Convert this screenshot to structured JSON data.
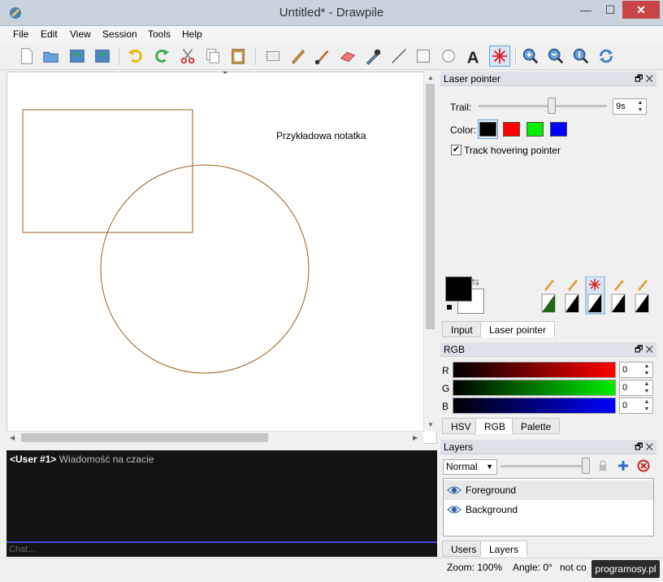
{
  "window": {
    "title": "Untitled* - Drawpile",
    "minimize": "—",
    "maximize": "☐",
    "close": "✕"
  },
  "menu": [
    "File",
    "Edit",
    "View",
    "Session",
    "Tools",
    "Help"
  ],
  "canvas": {
    "note_text": "Przykładowa notatka",
    "stroke_color": "#9a5f1e"
  },
  "chat": {
    "user": "<User #1>",
    "message": "Wiadomość na czacie",
    "placeholder": "Chat..."
  },
  "laser_panel": {
    "title": "Laser pointer",
    "trail_label": "Trail:",
    "trail_value": "9s",
    "color_label": "Color:",
    "colors": [
      "#000000",
      "#ff0000",
      "#00ee00",
      "#0000ff"
    ],
    "track_label": "Track hovering pointer",
    "track_checked": true
  },
  "tool_tabs": [
    "Input",
    "Laser pointer"
  ],
  "rgb_panel": {
    "title": "RGB",
    "rows": [
      {
        "label": "R",
        "value": "0",
        "color": "#ff0000"
      },
      {
        "label": "G",
        "value": "0",
        "color": "#00ee00"
      },
      {
        "label": "B",
        "value": "0",
        "color": "#0000ff"
      }
    ]
  },
  "color_tabs": [
    "HSV",
    "RGB",
    "Palette"
  ],
  "layers_panel": {
    "title": "Layers",
    "blend_mode": "Normal",
    "layers": [
      "Foreground",
      "Background"
    ]
  },
  "bottom_tabs": [
    "Users",
    "Layers"
  ],
  "status": {
    "zoom": "Zoom: 100%",
    "angle": "Angle: 0°",
    "connection": "not co"
  },
  "watermark": "programosy.pl"
}
